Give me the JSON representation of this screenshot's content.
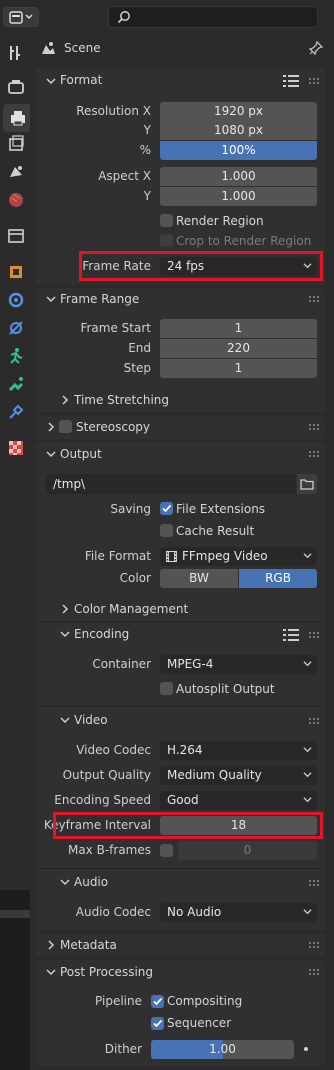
{
  "context": {
    "title": "Scene"
  },
  "format": {
    "title": "Format",
    "resolution_x_label": "Resolution X",
    "resolution_x": "1920 px",
    "resolution_y_label": "Y",
    "resolution_y": "1080 px",
    "resolution_pct_label": "%",
    "resolution_pct": "100%",
    "aspect_x_label": "Aspect X",
    "aspect_x": "1.000",
    "aspect_y_label": "Y",
    "aspect_y": "1.000",
    "render_region_label": "Render Region",
    "crop_label": "Crop to Render Region",
    "frame_rate_label": "Frame Rate",
    "frame_rate": "24 fps"
  },
  "frame_range": {
    "title": "Frame Range",
    "start_label": "Frame Start",
    "start": "1",
    "end_label": "End",
    "end": "220",
    "step_label": "Step",
    "step": "1",
    "time_stretching": "Time Stretching"
  },
  "stereoscopy": {
    "title": "Stereoscopy"
  },
  "output": {
    "title": "Output",
    "path": "/tmp\\",
    "saving_label": "Saving",
    "file_extensions_label": "File Extensions",
    "cache_result_label": "Cache Result",
    "file_format_label": "File Format",
    "file_format": "FFmpeg Video",
    "color_label": "Color",
    "color_bw": "BW",
    "color_rgb": "RGB",
    "color_management": "Color Management"
  },
  "encoding": {
    "title": "Encoding",
    "container_label": "Container",
    "container": "MPEG-4",
    "autosplit_label": "Autosplit Output"
  },
  "video": {
    "title": "Video",
    "codec_label": "Video Codec",
    "codec": "H.264",
    "quality_label": "Output Quality",
    "quality": "Medium Quality",
    "speed_label": "Encoding Speed",
    "speed": "Good",
    "keyframe_label": "Keyframe Interval",
    "keyframe": "18",
    "bframes_label": "Max B-frames",
    "bframes": "0"
  },
  "audio": {
    "title": "Audio",
    "codec_label": "Audio Codec",
    "codec": "No Audio"
  },
  "metadata": {
    "title": "Metadata"
  },
  "post_processing": {
    "title": "Post Processing",
    "pipeline_label": "Pipeline",
    "compositing_label": "Compositing",
    "sequencer_label": "Sequencer",
    "dither_label": "Dither",
    "dither": "1.00",
    "dither_fill": 0.5
  },
  "colors": {
    "accent": "#4772b3",
    "highlight": "#e0162b",
    "panel": "#303030"
  }
}
